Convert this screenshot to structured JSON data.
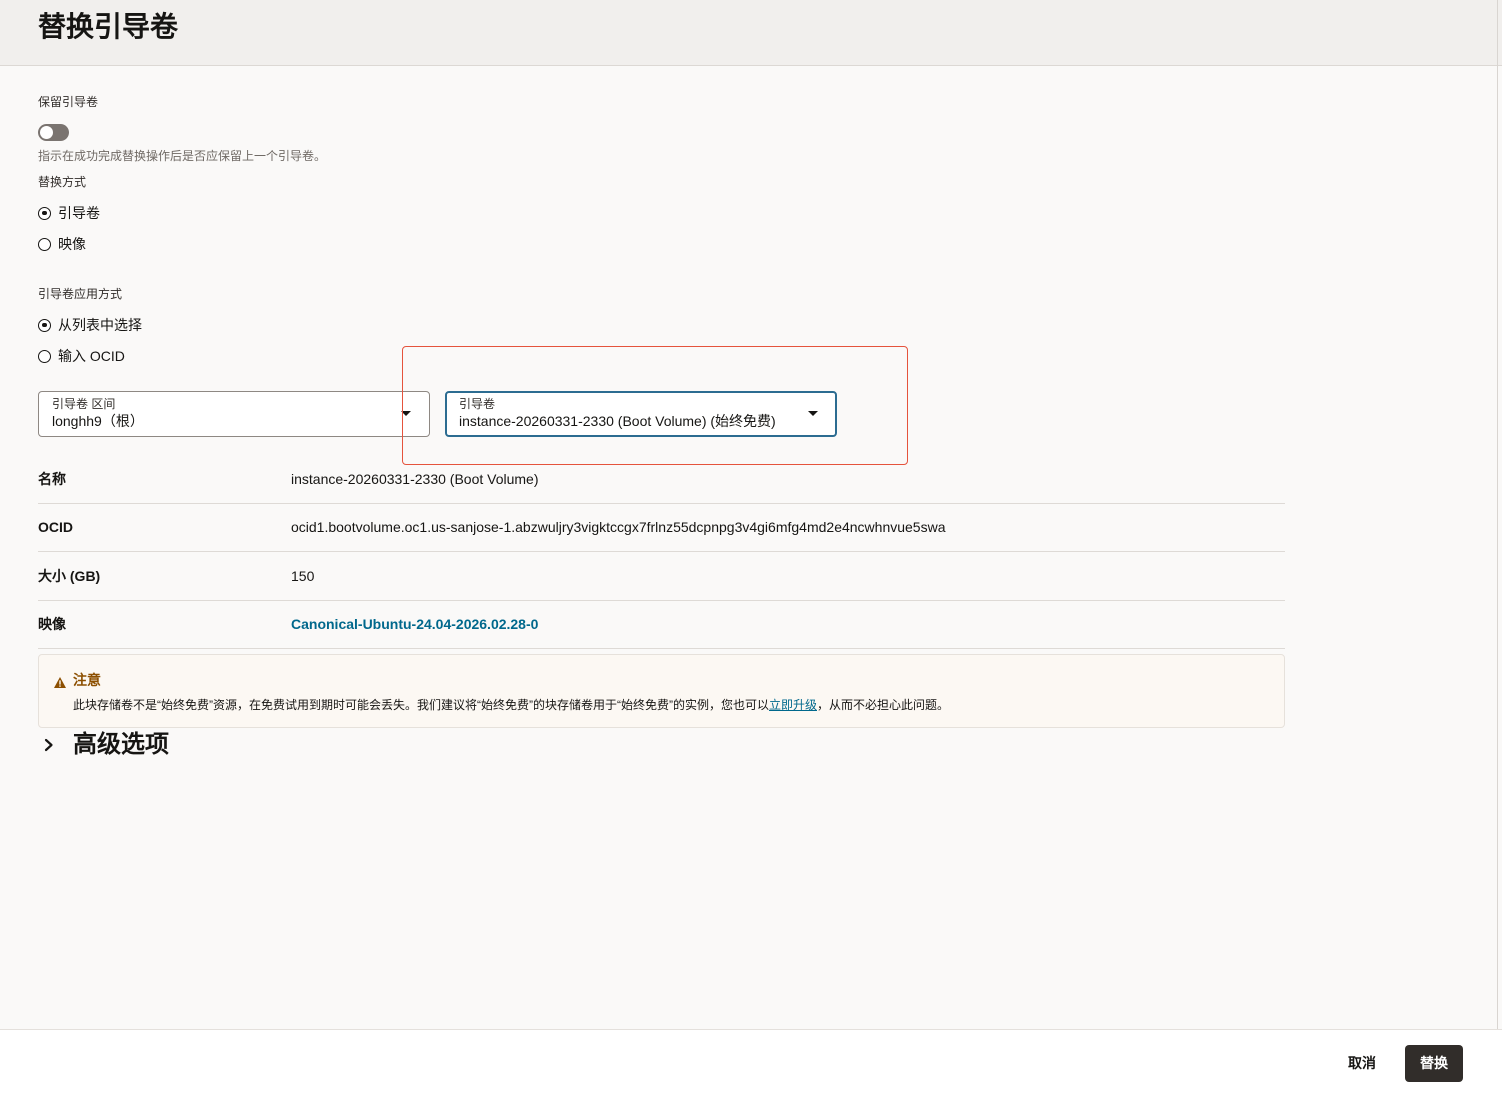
{
  "header": {
    "title": "替换引导卷"
  },
  "preserve_boot_volume": {
    "label": "保留引导卷",
    "toggle_on": false,
    "help_text": "指示在成功完成替换操作后是否应保留上一个引导卷。"
  },
  "replace_by": {
    "label": "替换方式",
    "options": [
      {
        "label": "引导卷",
        "selected": true
      },
      {
        "label": "映像",
        "selected": false
      }
    ]
  },
  "apply_by": {
    "label": "引导卷应用方式",
    "options": [
      {
        "label": "从列表中选择",
        "selected": true
      },
      {
        "label": "输入 OCID",
        "selected": false
      }
    ]
  },
  "compartment_select": {
    "label": "引导卷 区间",
    "value": "longhh9（根）"
  },
  "boot_volume_select": {
    "label": "引导卷",
    "value": "instance-20260331-2330 (Boot Volume) (始终免费)"
  },
  "details": [
    {
      "label": "名称",
      "value": "instance-20260331-2330 (Boot Volume)"
    },
    {
      "label": "OCID",
      "value": "ocid1.bootvolume.oc1.us-sanjose-1.abzwuljry3vigktccgx7frlnz55dcpnpg3v4gi6mfg4md2e4ncwhnvue5swa"
    },
    {
      "label": "大小 (GB)",
      "value": "150"
    },
    {
      "label": "映像",
      "value": "Canonical-Ubuntu-24.04-2026.02.28-0"
    }
  ],
  "notice": {
    "title": "注意",
    "text_before_link": "此块存储卷不是“始终免费”资源，在免费试用到期时可能会丢失。我们建议将“始终免费”的块存储卷用于“始终免费”的实例，您也可以",
    "link_label": "立即升级",
    "text_after_link": "，从而不必担心此问题。"
  },
  "advanced_options": {
    "label": "高级选项"
  },
  "footer": {
    "cancel_label": "取消",
    "submit_label": "替换"
  },
  "icons": {
    "warning": "warning-icon",
    "caret": "caret-down-icon",
    "chevron": "chevron-right-icon"
  },
  "colors": {
    "header_bg": "#f1efed",
    "page_bg": "#faf9f8",
    "text": "#161513",
    "link": "#00688c",
    "focus_border": "#2c6c91",
    "notice_bg": "#fcf8f3",
    "notice_title": "#8c4f00",
    "primary_button_bg": "#312d2a",
    "annotation": "#e5533d"
  }
}
